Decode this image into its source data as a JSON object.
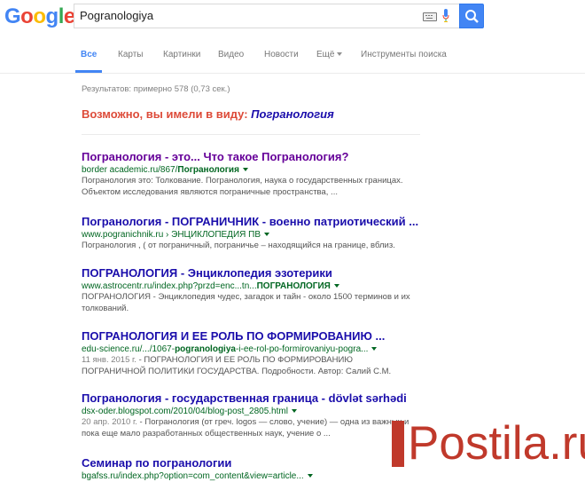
{
  "logo": {
    "letters": [
      {
        "ch": "G",
        "color": "#4285f4"
      },
      {
        "ch": "o",
        "color": "#ea4335"
      },
      {
        "ch": "o",
        "color": "#fbbc05"
      },
      {
        "ch": "g",
        "color": "#4285f4"
      },
      {
        "ch": "l",
        "color": "#34a853"
      },
      {
        "ch": "e",
        "color": "#ea4335"
      }
    ]
  },
  "search": {
    "query": "Pogranologiya"
  },
  "icons": {
    "keyboard": "keyboard-icon",
    "mic": "microphone-icon",
    "search": "search-icon"
  },
  "nav": {
    "all": "Все",
    "maps": "Карты",
    "images": "Картинки",
    "video": "Видео",
    "news": "Новости",
    "more": "Ещё",
    "tools": "Инструменты поиска"
  },
  "stats": "Результатов: примерно 578 (0,73 сек.)",
  "didyoumean": {
    "prefix": "Возможно, вы имели в виду:",
    "suggestion": "Погранология"
  },
  "results": [
    {
      "title": "Погранология - это... Что такое Погранология?",
      "url_plain": "border academic.ru/867/",
      "url_bold": "Погранология",
      "snippet": "Погранология это: Толкование. Погранология, наука о государственных границах. Объектом исследования являются пограничные пространства, ..."
    },
    {
      "title": "Погранология - ПОГРАНИЧНИК - военно патриотический ...",
      "url_plain": "www.pogranichnik.ru › ЭНЦИКЛОПЕДИЯ ПВ",
      "url_bold": "",
      "snippet": "Погранология , ( от пограничный, пограничье – находящийся на границе, вблиз."
    },
    {
      "title": "ПОГРАНОЛОГИЯ - Энциклопедия эзотерики",
      "url_plain": "www.astrocentr.ru/index.php?przd=enc...tn...",
      "url_bold": "ПОГРАНОЛОГИЯ",
      "snippet": "ПОГРАНОЛОГИЯ - Энциклопедия чудес, загадок и тайн - около 1500 терминов и их толкований."
    },
    {
      "title": "ПОГРАНОЛОГИЯ И ЕЕ РОЛЬ ПО ФОРМИРОВАНИЮ ...",
      "url_plain": "edu-science.ru/.../1067-",
      "url_bold": "pogranologiya",
      "url_tail": "-i-ee-rol-po-formirovaniyu-pogra...",
      "date": "11 янв. 2015 г.",
      "snippet": " - ПОГРАНОЛОГИЯ И ЕЕ РОЛЬ ПО ФОРМИРОВАНИЮ ПОГРАНИЧНОЙ ПОЛИТИКИ ГОСУДАРСТВА. Подробности. Автор: Салий С.М."
    },
    {
      "title": "Погранология - государственная граница - dövlət sərhədi",
      "url_plain": "dsx-oder.blogspot.com/2010/04/blog-post_2805.html",
      "url_bold": "",
      "date": "20 апр. 2010 г.",
      "snippet": " - Погранология (от греч. logos — слово, учение) — одна из важных и пока еще мало разработанных общественных наук, учение о ..."
    },
    {
      "title": "Семинар по погранологии",
      "url_plain": "bgafss.ru/index.php?option=com_content&view=article...",
      "url_bold": "",
      "snippet": ""
    }
  ],
  "watermark": {
    "text": "Postila.ru",
    "color": "#c0392b"
  }
}
